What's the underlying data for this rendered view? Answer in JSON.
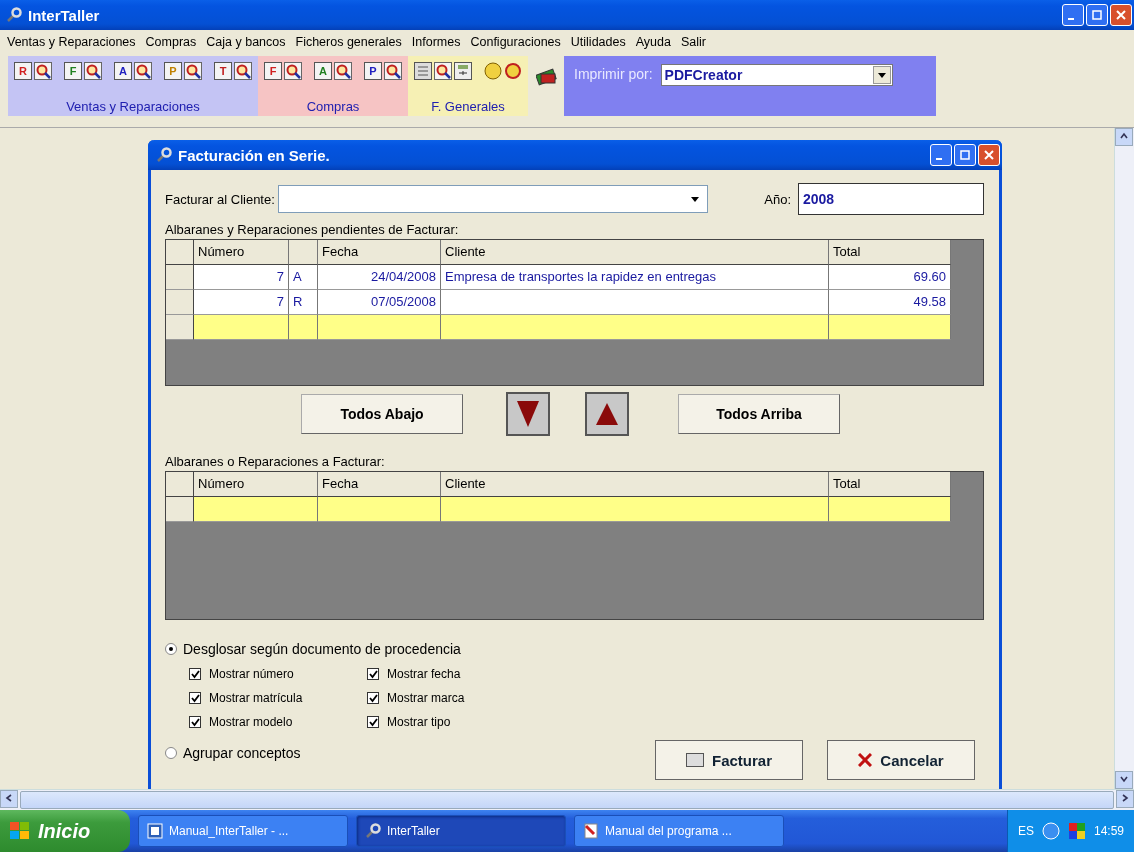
{
  "window": {
    "title": "InterTaller"
  },
  "menu": [
    "Ventas y Reparaciones",
    "Compras",
    "Caja y bancos",
    "Ficheros generales",
    "Informes",
    "Configuraciones",
    "Utilidades",
    "Ayuda",
    "Salir"
  ],
  "toolbar": {
    "groups": [
      {
        "label": "Ventas y Reparaciones",
        "color": "#c4c4f4",
        "letters": [
          "R",
          "F",
          "A",
          "P",
          "T"
        ]
      },
      {
        "label": "Compras",
        "color": "#f6c4c4",
        "letters": [
          "F",
          "A",
          "P"
        ]
      },
      {
        "label": "F. Generales",
        "color": "#f6f0b4"
      }
    ],
    "print_label": "Imprimir por:",
    "printer": "PDFCreator"
  },
  "dialog": {
    "title": "Facturación en Serie.",
    "client_label": "Facturar al Cliente:",
    "year_label": "Año:",
    "year": "2008",
    "pending": {
      "label": "Albaranes y Reparaciones pendientes de Facturar:",
      "columns": [
        "Número",
        "Fecha",
        "Cliente",
        "Total"
      ],
      "new_row": true,
      "rows": [
        {
          "numero": "7",
          "tipo": "A",
          "fecha": "24/04/2008",
          "cliente": "Empresa de transportes la rapidez en entregas",
          "total": "69.60"
        },
        {
          "numero": "7",
          "tipo": "R",
          "fecha": "07/05/2008",
          "total": "49.58"
        }
      ]
    },
    "buttons": [
      "Todos Abajo",
      "Todos Arriba"
    ],
    "selected": {
      "label": "Albaranes o Reparaciones a Facturar:",
      "columns": [
        "Número",
        "Fecha",
        "Cliente",
        "Total"
      ],
      "new_row": true
    },
    "options": [
      {
        "label": "Desglosar según documento de procedencia",
        "selected": true
      },
      {
        "label": "Agrupar conceptos",
        "selected": false
      }
    ],
    "checks": [
      {
        "label": "Mostrar número",
        "checked": true
      },
      {
        "label": "Mostrar fecha",
        "checked": true
      },
      {
        "label": "Mostrar matrícula",
        "checked": true
      },
      {
        "label": "Mostrar marca",
        "checked": true
      },
      {
        "label": "Mostrar modelo",
        "checked": true
      },
      {
        "label": "Mostrar tipo",
        "checked": true
      }
    ],
    "actions": [
      "Facturar",
      "Cancelar"
    ]
  },
  "taskbar": {
    "start": "Inicio",
    "tasks": [
      {
        "label": "Manual_InterTaller - ...",
        "selected": false
      },
      {
        "label": "InterTaller",
        "selected": true
      },
      {
        "label": "Manual del programa ...",
        "selected": false
      }
    ],
    "language": "ES",
    "clock": "14:59"
  }
}
